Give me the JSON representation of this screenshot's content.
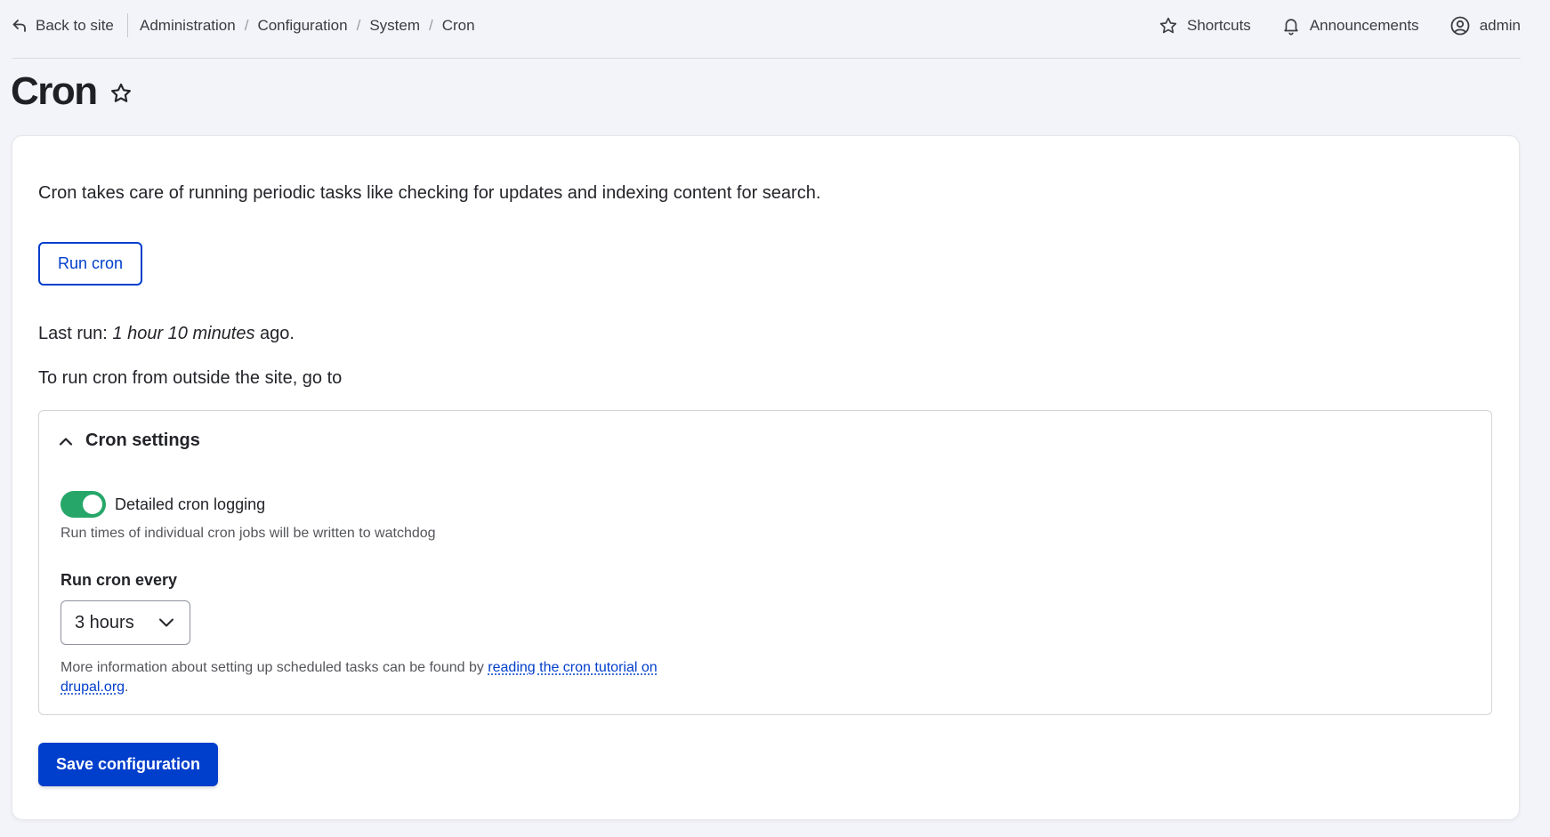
{
  "header": {
    "back_label": "Back to site",
    "breadcrumb": [
      "Administration",
      "Configuration",
      "System",
      "Cron"
    ],
    "shortcuts_label": "Shortcuts",
    "announcements_label": "Announcements",
    "user_label": "admin"
  },
  "page": {
    "title": "Cron"
  },
  "main": {
    "intro": "Cron takes care of running periodic tasks like checking for updates and indexing content for search.",
    "run_button": "Run cron",
    "last_run_prefix": "Last run: ",
    "last_run_value": "1 hour 10 minutes",
    "last_run_suffix": " ago.",
    "outside_text": "To run cron from outside the site, go to"
  },
  "settings": {
    "title": "Cron settings",
    "toggle_label": "Detailed cron logging",
    "toggle_on": true,
    "toggle_description": "Run times of individual cron jobs will be written to watchdog",
    "interval_label": "Run cron every",
    "interval_value": "3 hours",
    "help_text": "More information about setting up scheduled tasks can be found by ",
    "help_link": "reading the cron tutorial on drupal.org",
    "help_end": "."
  },
  "actions": {
    "save_label": "Save configuration"
  },
  "colors": {
    "accent": "#003ecc",
    "toggle_on": "#26a769",
    "background": "#f3f4f9"
  }
}
